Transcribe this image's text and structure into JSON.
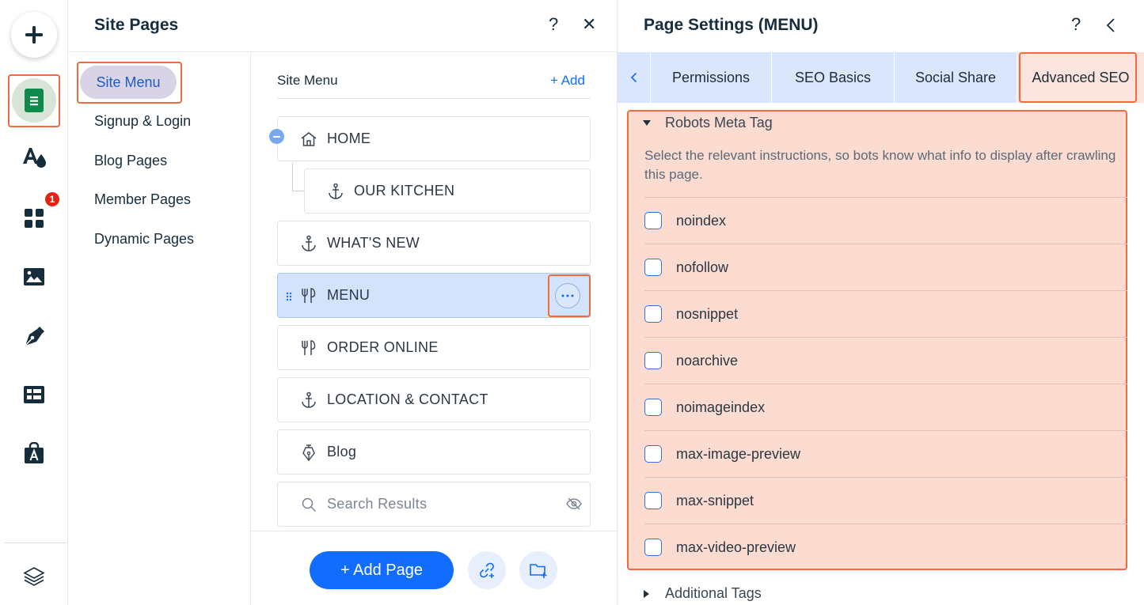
{
  "rail": {
    "badge_count": "1",
    "icons": [
      "add-icon",
      "pages-icon",
      "design-icon",
      "apps-icon",
      "media-icon",
      "blog-icon",
      "cms-icon",
      "app-market-icon",
      "layers-icon"
    ]
  },
  "site_pages": {
    "title": "Site Pages",
    "help": "?",
    "close": "✕",
    "nav": {
      "active": "Site Menu",
      "items": [
        "Signup & Login",
        "Blog Pages",
        "Member Pages",
        "Dynamic Pages"
      ]
    },
    "list": {
      "header": "Site Menu",
      "add_label": "+ Add",
      "pages": [
        {
          "label": "HOME",
          "icon": "home-icon"
        },
        {
          "label": "OUR KITCHEN",
          "icon": "anchor-icon"
        },
        {
          "label": "WHAT'S NEW",
          "icon": "anchor-icon"
        },
        {
          "label": "MENU",
          "icon": "restaurant-icon"
        },
        {
          "label": "ORDER ONLINE",
          "icon": "restaurant-icon"
        },
        {
          "label": "LOCATION & CONTACT",
          "icon": "anchor-icon"
        },
        {
          "label": "Blog",
          "icon": "pen-icon"
        },
        {
          "label": "Search Results",
          "icon": "search-icon"
        }
      ]
    },
    "footer": {
      "add_page_label": "+ Add Page"
    }
  },
  "page_settings": {
    "title": "Page Settings (MENU)",
    "help": "?",
    "tabs": [
      "Permissions",
      "SEO Basics",
      "Social Share",
      "Advanced SEO"
    ],
    "active_tab": "Advanced SEO",
    "robots": {
      "heading": "Robots Meta Tag",
      "description": "Select the relevant instructions, so bots know what info to display after crawling this page.",
      "options": [
        "noindex",
        "nofollow",
        "nosnippet",
        "noarchive",
        "noimageindex",
        "max-image-preview",
        "max-snippet",
        "max-video-preview"
      ]
    },
    "additional_heading": "Additional Tags"
  },
  "colors": {
    "accent": "#116dff",
    "highlight": "#ef6a3f",
    "selected_page": "#d3e3fb"
  }
}
